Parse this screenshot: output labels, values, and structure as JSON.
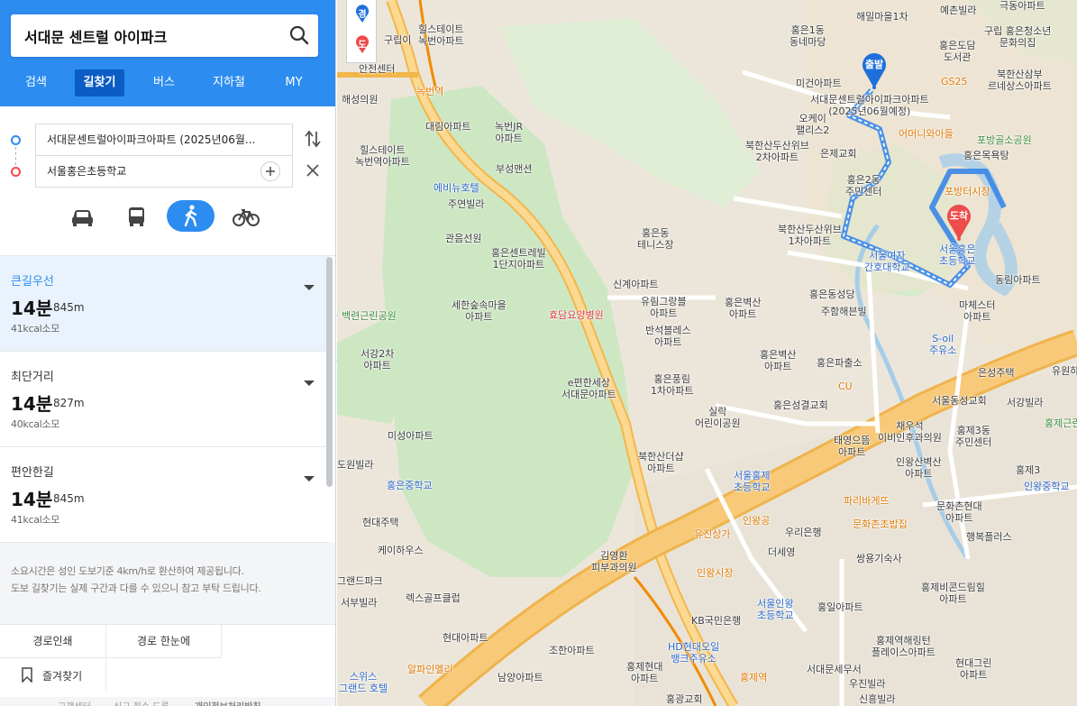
{
  "search": {
    "value": "서대문 센트럴 아이파크",
    "placeholder": ""
  },
  "nav_tabs": [
    {
      "label": "검색",
      "active": false
    },
    {
      "label": "길찾기",
      "active": true
    },
    {
      "label": "버스",
      "active": false
    },
    {
      "label": "지하철",
      "active": false
    },
    {
      "label": "MY",
      "active": false
    }
  ],
  "route": {
    "origin": "서대문센트럴아이파크아파트 (2025년06월...",
    "destination": "서울홍은초등학교",
    "modes": [
      {
        "icon": "car-icon",
        "active": false
      },
      {
        "icon": "bus-icon",
        "active": false
      },
      {
        "icon": "walk-icon",
        "active": true
      },
      {
        "icon": "bicycle-icon",
        "active": false
      }
    ]
  },
  "results": [
    {
      "label": "큰길우선",
      "time": "14분",
      "distance": "845m",
      "kcal": "41kcal소모",
      "selected": true
    },
    {
      "label": "최단거리",
      "time": "14분",
      "distance": "827m",
      "kcal": "40kcal소모",
      "selected": false
    },
    {
      "label": "편안한길",
      "time": "14분",
      "distance": "845m",
      "kcal": "41kcal소모",
      "selected": false
    }
  ],
  "notice": {
    "line1": "소요시간은 성인 도보기준 4km/h로 환산하여 제공됩니다.",
    "line2": "도보 길찾기는 실제 구간과 다를 수 있으니 참고 부탁 드립니다."
  },
  "bottom": {
    "print": "경로인쇄",
    "overview": "경로 한눈에",
    "bookmark": "즐겨찾기"
  },
  "footer": [
    "고객센터",
    "신고 접수 도록",
    "개인정보처리방침"
  ],
  "map": {
    "start_pin": "출발",
    "end_pin": "도착",
    "marker_gyeong": "경",
    "marker_do": "도",
    "labels": {
      "l1": "힐스테이트",
      "l1b": "녹번아파트",
      "l2": "힐스테이트",
      "l2b": "녹번역아파트",
      "l3": "대림아파트",
      "l4": "녹번JR",
      "l4b": "아파트",
      "l5": "부성맨션",
      "l6": "에비뉴호텔",
      "l7": "주연빌라",
      "l8": "관음선원",
      "l9": "홍은센트레빌",
      "l9b": "1단지아파트",
      "l10": "세한숲속마을",
      "l10b": "아파트",
      "l11": "효담요양병원",
      "l12": "홍은동",
      "l12b": "테니스장",
      "l13": "신계아파트",
      "l14": "유림그랑블",
      "l14b": "아파트",
      "l15": "반석블레스",
      "l15b": "아파트",
      "l16": "홍은풍림",
      "l16b": "1차아파트",
      "l17": "e편한세상",
      "l17b": "서대문아파트",
      "l18": "북한산더샵",
      "l18b": "아파트",
      "l19": "실락",
      "l19b": "어린이공원",
      "l20": "홍은벽산",
      "l20b": "아파트",
      "l21": "홍은벽산",
      "l21b": "아파트",
      "l22": "홍은파출소",
      "l23": "홍은성결교회",
      "l24": "해밀마을1차",
      "l25": "예촌빌라",
      "l26": "홍은1동",
      "l26b": "동네마당",
      "l27": "홍은도담",
      "l27b": "도서관",
      "l28": "구립 홍은청소년",
      "l28b": "문화의집",
      "l29": "북한산삼부",
      "l29b": "르네상스아파트",
      "l30": "미건아파트",
      "l31": "GS25",
      "l32": "서대문센트럴아이파크아파트",
      "l32b": "(2025년06월예정)",
      "l33": "오케이",
      "l33b": "팰리스2",
      "l34": "어머니와아들",
      "l35": "포방골소공원",
      "l36": "북한산두산위브",
      "l36b": "2차아파트",
      "l37": "은제교회",
      "l38": "홍은목욕탕",
      "l39": "홍은2동",
      "l39b": "주민센터",
      "l40": "포방터시장",
      "l41": "북한산두산위브",
      "l41b": "1차아파트",
      "l42": "서울여자",
      "l42b": "간호대학교",
      "l43": "서울홍은",
      "l43b": "초등학교",
      "l44": "동림아파트",
      "l45": "마체스터",
      "l45b": "아파트",
      "l46": "홍은동성당",
      "l47": "주함해븐빌",
      "l48": "S-oil",
      "l48b": "주유소",
      "l49": "CU",
      "l50": "은성주택",
      "l51": "서울동성교회",
      "l52": "서강빌라",
      "l53": "채우석",
      "l53b": "이비인후과의원",
      "l54": "홍제3동",
      "l54b": "주민센터",
      "l55": "태영으뜸",
      "l55b": "아파트",
      "l56": "인왕산벽산",
      "l56b": "아파트",
      "l57": "서울홍제",
      "l57b": "초등학교",
      "l58": "파리바게뜨",
      "l59": "문화촌현대",
      "l59b": "아파트",
      "l60": "인왕공",
      "l61": "우리은행",
      "l62": "문화촌초밥집",
      "l63": "유진상가",
      "l64": "행복플러스",
      "l65": "인왕시장",
      "l66": "더세영",
      "l67": "쌍용기숙사",
      "l68": "홍제비콘드림힐",
      "l68b": "아파트",
      "l69": "서울인왕",
      "l69b": "초등학교",
      "l70": "홍일아파트",
      "l71": "KB국민은행",
      "l72": "김영환",
      "l72b": "피부과의원",
      "l73": "HD현대오일",
      "l73b": "뱅크주유소",
      "l74": "홍제역해링턴",
      "l74b": "플레이스아파트",
      "l75": "홍제현대",
      "l75b": "아파트",
      "l76": "서대문세무서",
      "l77": "현대그린",
      "l77b": "아파트",
      "l78": "우진빌라",
      "l79": "홍광교회",
      "l80": "신흥빌라",
      "l81": "조한아파트",
      "l82": "남양아파트",
      "l83": "현대아파트",
      "l84": "알파인멜리",
      "l85": "렉스골프클럽",
      "l86": "홍은중학교",
      "l87": "미성아파트",
      "l88": "현대주택",
      "l89": "케이하우스",
      "l90": "서강2차",
      "l90b": "아파트",
      "l91": "백련근린공원",
      "l92": "도원빌라",
      "l93": "서부빌라",
      "l94": "그랜드파크",
      "l95": "스위스",
      "l95b": "그랜드 호텔",
      "l96": "홍제3",
      "l97": "인왕중학교",
      "l98": "유원하",
      "l99": "홍제근린",
      "l100": "해성의원",
      "l101": "안전센터",
      "l102": "녹번역",
      "l103": "홍제역",
      "l104": "구립이",
      "l105": "극동아파트"
    }
  },
  "colors": {
    "brand": "#2d8cf0",
    "route": "#3a86e8",
    "start_pin": "#1e6fd9",
    "end_pin": "#ef4b4b"
  }
}
